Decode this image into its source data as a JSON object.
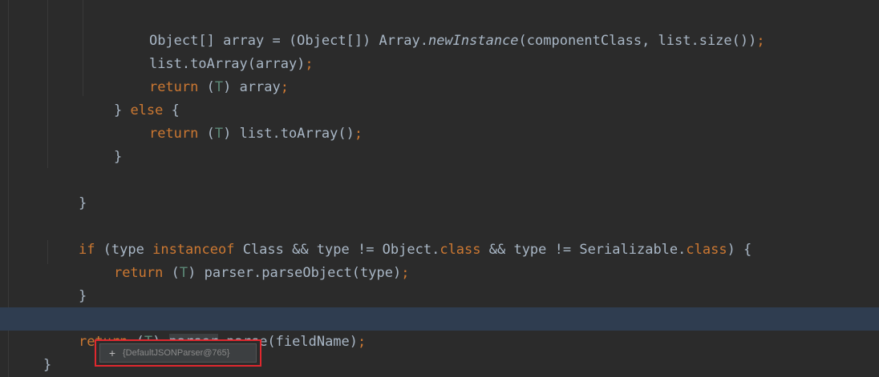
{
  "code": {
    "line0": {
      "object_type": "Object[] array = (Object[]) Array.",
      "new_instance": "newInstance",
      "args": "(componentClass, list.size())",
      "semi": ";"
    },
    "line1": {
      "text": "list.toArray(array)",
      "semi": ";"
    },
    "line2": {
      "kw": "return",
      "open": " (",
      "t": "T",
      "close": ") array",
      "semi": ";"
    },
    "line3": {
      "brace": "} ",
      "kw": "else",
      "rest": " {"
    },
    "line4": {
      "kw": "return",
      "open": " (",
      "t": "T",
      "close": ") list.toArray()",
      "semi": ";"
    },
    "line5": {
      "text": "}"
    },
    "line7": {
      "text": "}"
    },
    "line9": {
      "kw_if": "if",
      "part1": " (type ",
      "kw_instanceof": "instanceof",
      "part2": " Class && type != Object.",
      "kw_class1": "class",
      "part3": " && type != Serializable.",
      "kw_class2": "class",
      "part4": ") {"
    },
    "line10": {
      "kw": "return",
      "open": " (",
      "t": "T",
      "close": ") parser.parseObject(type)",
      "semi": ";"
    },
    "line11": {
      "text": "}"
    },
    "line13": {
      "kw": "return",
      "open": " (",
      "t": "T",
      "close": ") ",
      "parser": "parser",
      "rest": ".parse(fieldName)",
      "semi": ";"
    },
    "line14": {
      "text": "}"
    }
  },
  "tooltip": {
    "expand_icon": "+",
    "value": "{DefaultJSONParser@765}"
  },
  "colors": {
    "background": "#2b2b2b",
    "keyword": "#cc7832",
    "text": "#a9b7c6",
    "generic_type": "#5d8a78",
    "current_line": "#2f3d50",
    "highlight_border": "#e0282e"
  }
}
